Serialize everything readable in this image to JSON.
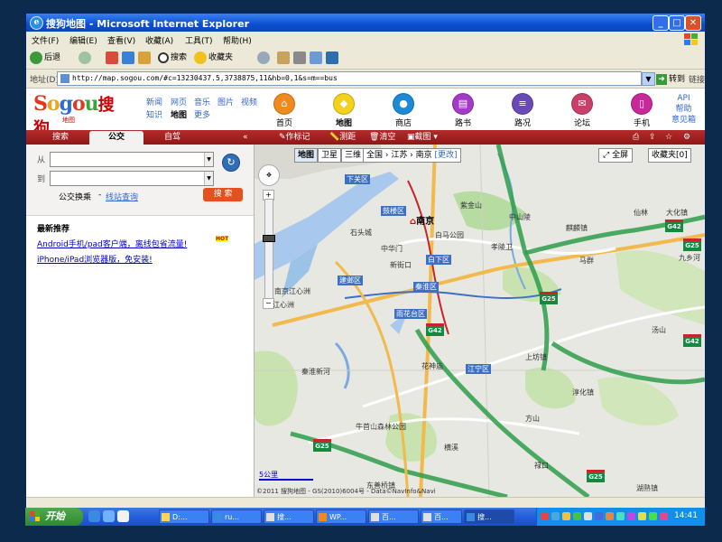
{
  "window": {
    "title": "搜狗地图 - Microsoft Internet Explorer",
    "min": "_",
    "max": "□",
    "close": "✕"
  },
  "menu": [
    "文件(F)",
    "编辑(E)",
    "查看(V)",
    "收藏(A)",
    "工具(T)",
    "帮助(H)"
  ],
  "toolbar": {
    "back": "后退",
    "search": "搜索",
    "favorites": "收藏夹"
  },
  "address": {
    "label": "地址(D)",
    "url": "http://map.sogou.com/#c=13230437.5,3738875,11&hb=0,1&s=m==bus",
    "go": "转到",
    "links": "链接"
  },
  "sogou": {
    "logo": "Sogou搜狗",
    "logo_sub": "地图",
    "channels_row1": [
      "新闻",
      "网页",
      "音乐",
      "图片",
      "视频"
    ],
    "channels_row2": [
      "知识",
      "地图",
      "更多"
    ],
    "current_channel": "地图",
    "nav": [
      "首页",
      "地图",
      "商店",
      "路书",
      "路况",
      "论坛",
      "手机"
    ],
    "api": [
      "API",
      "帮助",
      "意见箱"
    ]
  },
  "tabs": [
    "搜索",
    "公交",
    "自驾"
  ],
  "active_tab": "公交",
  "collapse": "«",
  "map_tools": [
    "作标记",
    "测距",
    "清空",
    "截图"
  ],
  "bus_search": {
    "from_label": "从",
    "to_label": "到",
    "from_value": "",
    "to_value": "",
    "mode": "公交换乘",
    "sep": "-",
    "station_query": "线站查询",
    "submit": "搜 索"
  },
  "recommend": {
    "title": "最新推荐",
    "items": [
      "Android手机/pad客户端，离线包省流量!",
      "iPhone/iPad浏览器版，免安装!"
    ],
    "hot": "HOT"
  },
  "map": {
    "types": [
      "地图",
      "卫星",
      "三维"
    ],
    "active_type": "地图",
    "breadcrumb": "全国 › 江苏 › 南京",
    "change": "[更改]",
    "fullscreen": "全屏",
    "favorites": "收藏夹[0]",
    "city": "南京",
    "stations": [
      "下关区",
      "鼓楼区",
      "白下区",
      "建邺区",
      "秦淮区",
      "雨花台区",
      "江宁区"
    ],
    "labels": [
      "石头城",
      "紫金山",
      "中山陵",
      "麒麟镇",
      "马群",
      "南京江心洲",
      "江心洲",
      "孝陵卫",
      "白马公园",
      "花神庙",
      "秦淮新河",
      "仙林",
      "方山",
      "汤山",
      "淳化镇",
      "上坊镇",
      "牛首山森林公园",
      "东善桥镇",
      "湖熟镇",
      "禄口",
      "大化镇",
      "九乡河",
      "横溪",
      "中华门",
      "新街口"
    ],
    "highways": [
      "G25",
      "G42",
      "G25",
      "G42",
      "G25",
      "G25",
      "G42"
    ],
    "scale": "5公里",
    "copyright": "©2011 搜狗地图 - GS(2010)6004号 - Data©NavInfo&Navi"
  },
  "taskbar": {
    "start": "开始",
    "tasks": [
      "D:...",
      "ru...",
      "搜...",
      "WP...",
      "百...",
      "百...",
      "搜..."
    ],
    "clock": "14:41"
  },
  "colors": {
    "brand_red": "#b52b2b",
    "taskbar_blue": "#245edc",
    "start_green": "#3a9a3a",
    "map_land": "#e8e8e3",
    "water": "#a9c8ee",
    "park": "#b7dca2"
  }
}
